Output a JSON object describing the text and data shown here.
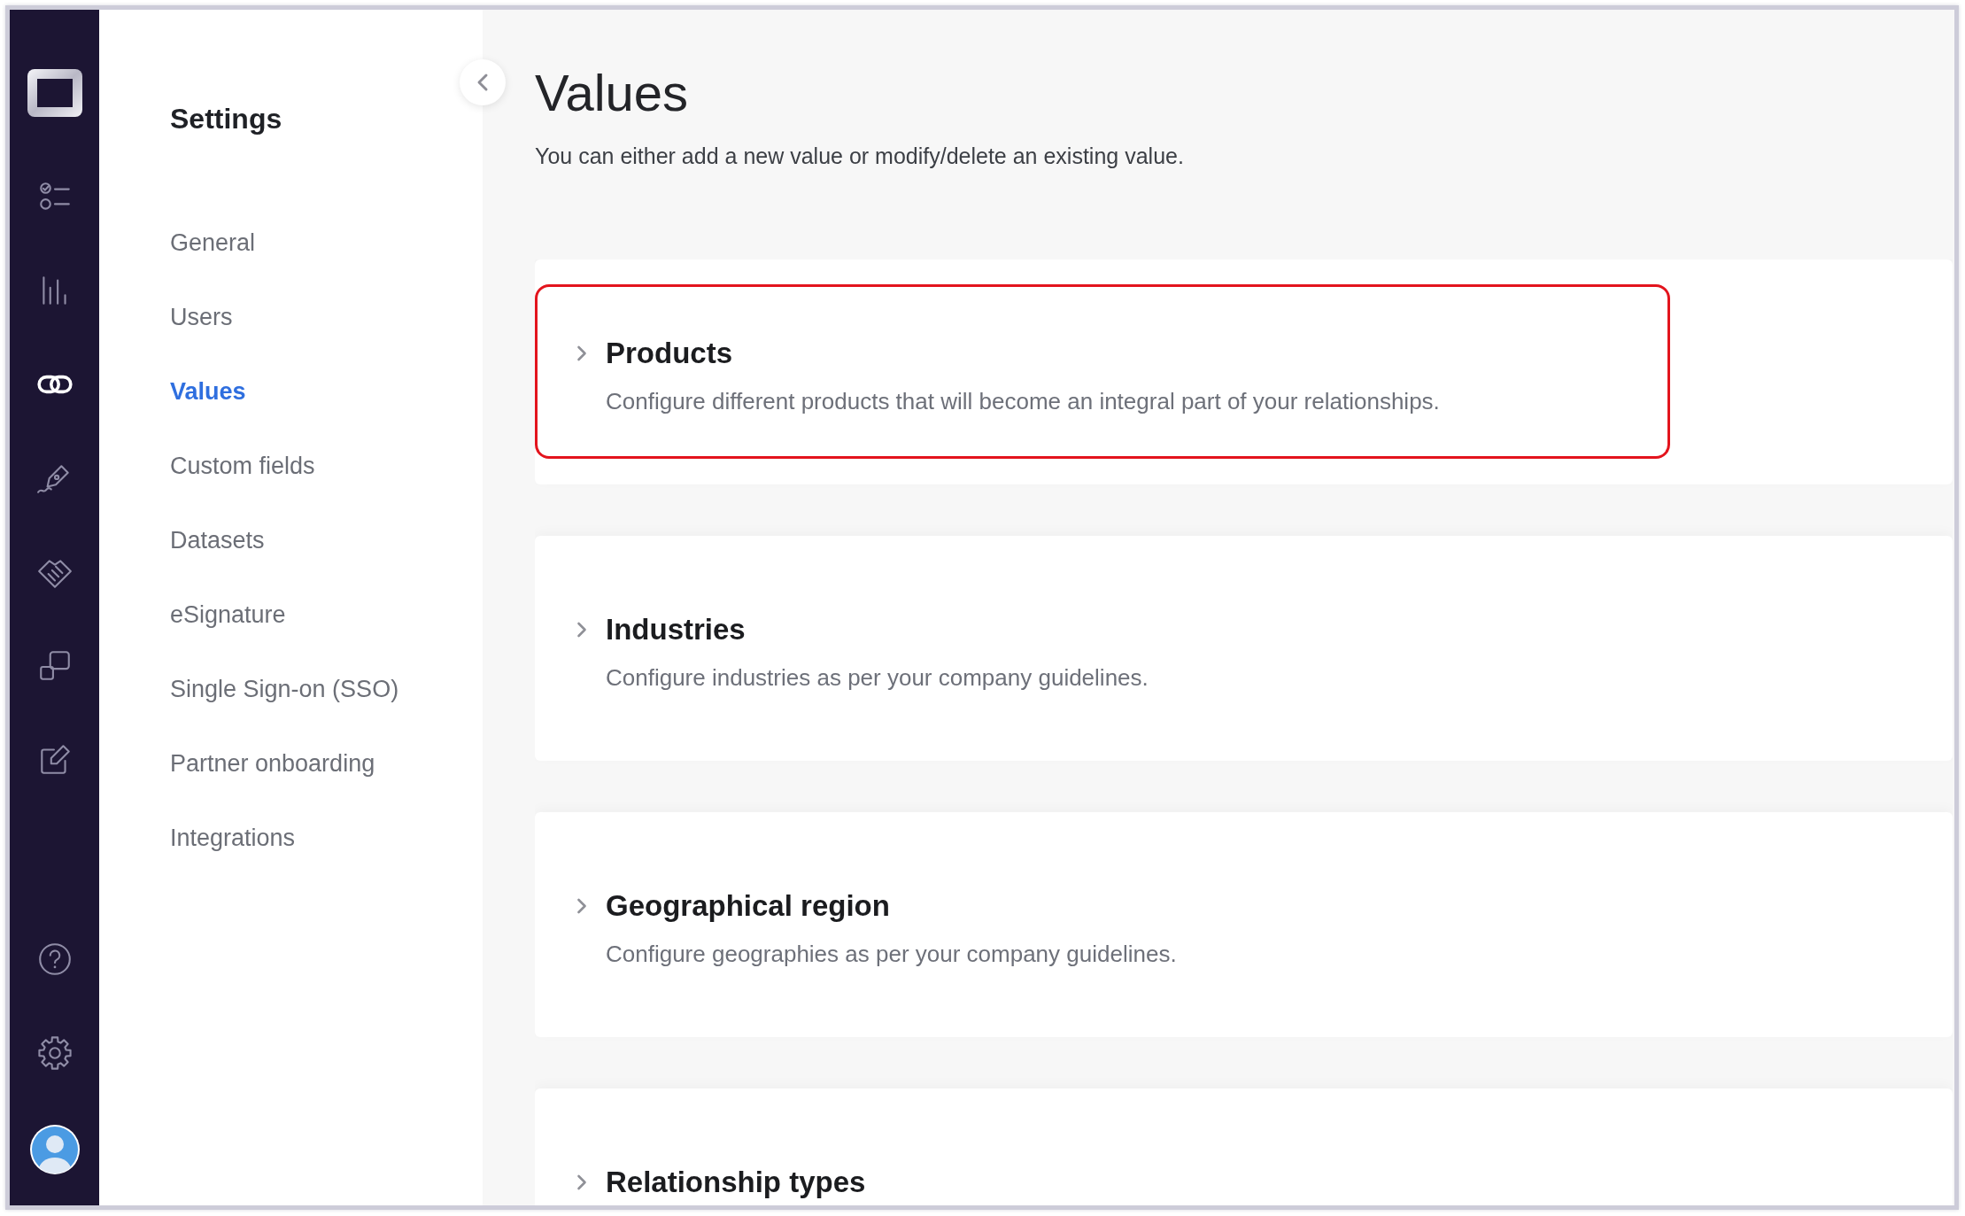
{
  "rail": {
    "items": [
      {
        "selected": false
      },
      {
        "selected": false
      },
      {
        "selected": true
      },
      {
        "selected": false
      },
      {
        "selected": false
      },
      {
        "selected": false
      },
      {
        "selected": false
      }
    ],
    "bottom_items": [
      {
        "selected": false
      },
      {
        "selected": false
      }
    ]
  },
  "sidebar": {
    "title": "Settings",
    "items": [
      {
        "label": "General",
        "selected": false
      },
      {
        "label": "Users",
        "selected": false
      },
      {
        "label": "Values",
        "selected": true
      },
      {
        "label": "Custom fields",
        "selected": false
      },
      {
        "label": "Datasets",
        "selected": false
      },
      {
        "label": "eSignature",
        "selected": false
      },
      {
        "label": "Single Sign-on (SSO)",
        "selected": false
      },
      {
        "label": "Partner onboarding",
        "selected": false
      },
      {
        "label": "Integrations",
        "selected": false
      }
    ]
  },
  "page": {
    "title": "Values",
    "subtitle": "You can either add a new value or modify/delete an existing value."
  },
  "value_groups": [
    {
      "title": "Products",
      "description": "Configure different products that will become an integral part of your relationships.",
      "highlighted": true
    },
    {
      "title": "Industries",
      "description": "Configure industries as per your company guidelines.",
      "highlighted": false
    },
    {
      "title": "Geographical region",
      "description": "Configure geographies as per your company guidelines.",
      "highlighted": false
    },
    {
      "title": "Relationship types",
      "highlighted": false
    }
  ]
}
